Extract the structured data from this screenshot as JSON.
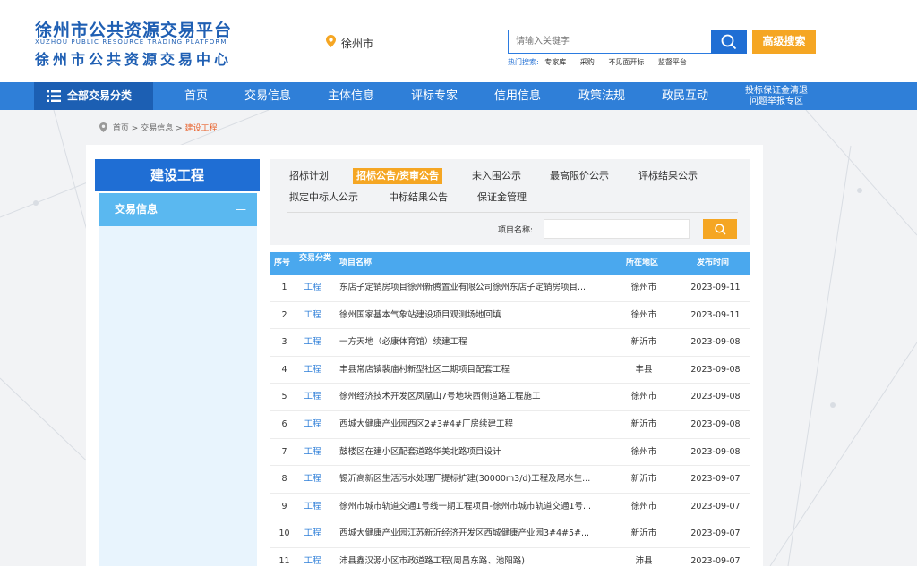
{
  "header": {
    "logo_cn_1": "徐州市公共资源交易平台",
    "logo_en": "XUZHOU PUBLIC RESOURCE TRADING PLATFORM",
    "logo_cn_2": "徐州市公共资源交易中心",
    "location": "徐州市",
    "search_placeholder": "请输入关键字",
    "advanced_search": "高级搜索",
    "hot_label": "热门搜索:",
    "hot_items": [
      "专家库",
      "采购",
      "不见面开标",
      "监督平台"
    ]
  },
  "nav": {
    "all_categories": "全部交易分类",
    "items": [
      "首页",
      "交易信息",
      "主体信息",
      "评标专家",
      "信用信息",
      "政策法规",
      "政民互动"
    ],
    "special_line1": "投标保证金清退",
    "special_line2": "问题举报专区"
  },
  "breadcrumb": {
    "home": "首页",
    "sep1": ">",
    "level2": "交易信息",
    "sep2": ">",
    "current": "建设工程"
  },
  "sidebar": {
    "title": "建设工程",
    "item": "交易信息",
    "item_toggle": "—"
  },
  "tabs": {
    "items": [
      "招标计划",
      "招标公告/资审公告",
      "未入围公示",
      "最高限价公示",
      "评标结果公示",
      "拟定中标人公示",
      "中标结果公告",
      "保证金管理"
    ],
    "active": "招标公告/资审公告"
  },
  "filter": {
    "label": "项目名称:",
    "value": ""
  },
  "table": {
    "headers": {
      "no": "序号",
      "category": "交易分类",
      "name": "项目名称",
      "area": "所在地区",
      "date": "发布时间"
    },
    "rows": [
      {
        "no": "1",
        "category": "工程",
        "name": "东店子定销房项目徐州新腾置业有限公司徐州东店子定销房项目...",
        "area": "徐州市",
        "date": "2023-09-11"
      },
      {
        "no": "2",
        "category": "工程",
        "name": "徐州国家基本气象站建设项目观测场地回填",
        "area": "徐州市",
        "date": "2023-09-11"
      },
      {
        "no": "3",
        "category": "工程",
        "name": "一方天地（必康体育馆）续建工程",
        "area": "新沂市",
        "date": "2023-09-08"
      },
      {
        "no": "4",
        "category": "工程",
        "name": "丰县常店镇裴庙村新型社区二期项目配套工程",
        "area": "丰县",
        "date": "2023-09-08"
      },
      {
        "no": "5",
        "category": "工程",
        "name": "徐州经济技术开发区凤凰山7号地块西侧道路工程施工",
        "area": "徐州市",
        "date": "2023-09-08"
      },
      {
        "no": "6",
        "category": "工程",
        "name": "西城大健康产业园西区2#3#4#厂房续建工程",
        "area": "新沂市",
        "date": "2023-09-08"
      },
      {
        "no": "7",
        "category": "工程",
        "name": "鼓楼区在建小区配套道路华美北路项目设计",
        "area": "徐州市",
        "date": "2023-09-08"
      },
      {
        "no": "8",
        "category": "工程",
        "name": "锡沂高新区生活污水处理厂提标扩建(30000m3/d)工程及尾水生...",
        "area": "新沂市",
        "date": "2023-09-07"
      },
      {
        "no": "9",
        "category": "工程",
        "name": "徐州市城市轨道交通1号线一期工程项目-徐州市城市轨道交通1号...",
        "area": "徐州市",
        "date": "2023-09-07"
      },
      {
        "no": "10",
        "category": "工程",
        "name": "西城大健康产业园江苏新沂经济开发区西城健康产业园3#4#5#...",
        "area": "新沂市",
        "date": "2023-09-07"
      },
      {
        "no": "11",
        "category": "工程",
        "name": "沛县鑫汉源小区市政道路工程(周昌东路、池阳路)",
        "area": "沛县",
        "date": "2023-09-07"
      }
    ]
  },
  "colors": {
    "brand_blue": "#1f5fb3",
    "nav_blue": "#2f7fd8",
    "accent_orange": "#f5a623",
    "table_head": "#4aa8ee",
    "sidebar_item": "#5ab8f0"
  }
}
